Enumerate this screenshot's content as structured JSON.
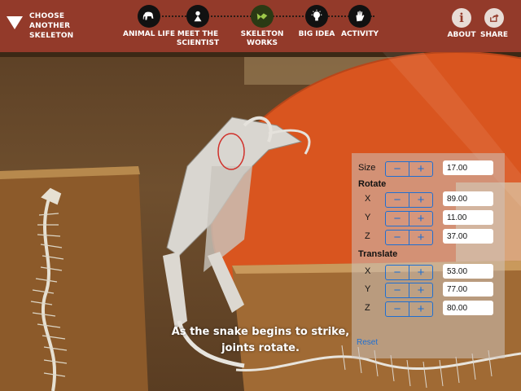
{
  "header": {
    "choose_label": "CHOOSE ANOTHER SKELETON",
    "nav": [
      {
        "label": "ANIMAL LIFE",
        "icon": "elephant-icon"
      },
      {
        "label": "MEET THE SCIENTIST",
        "icon": "lightbulb-person-icon"
      },
      {
        "label": "SKELETON WORKS",
        "icon": "skeleton-works-icon"
      },
      {
        "label": "BIG IDEA",
        "icon": "lightbulb-icon"
      },
      {
        "label": "ACTIVITY",
        "icon": "hand-icon"
      }
    ],
    "about_label": "ABOUT",
    "about_glyph": "i",
    "share_label": "SHARE"
  },
  "caption": "As the snake begins to strike, joints rotate.",
  "controls": {
    "size": {
      "label": "Size",
      "value": "17.00"
    },
    "rotate": {
      "title": "Rotate",
      "x": {
        "label": "X",
        "value": "89.00"
      },
      "y": {
        "label": "Y",
        "value": "11.00"
      },
      "z": {
        "label": "Z",
        "value": "37.00"
      }
    },
    "translate": {
      "title": "Translate",
      "x": {
        "label": "X",
        "value": "53.00"
      },
      "y": {
        "label": "Y",
        "value": "77.00"
      },
      "z": {
        "label": "Z",
        "value": "80.00"
      }
    },
    "minus": "−",
    "plus": "+",
    "reset_label": "Reset"
  },
  "colors": {
    "topbar": "#933a2a",
    "accent": "#1f6fd1"
  }
}
